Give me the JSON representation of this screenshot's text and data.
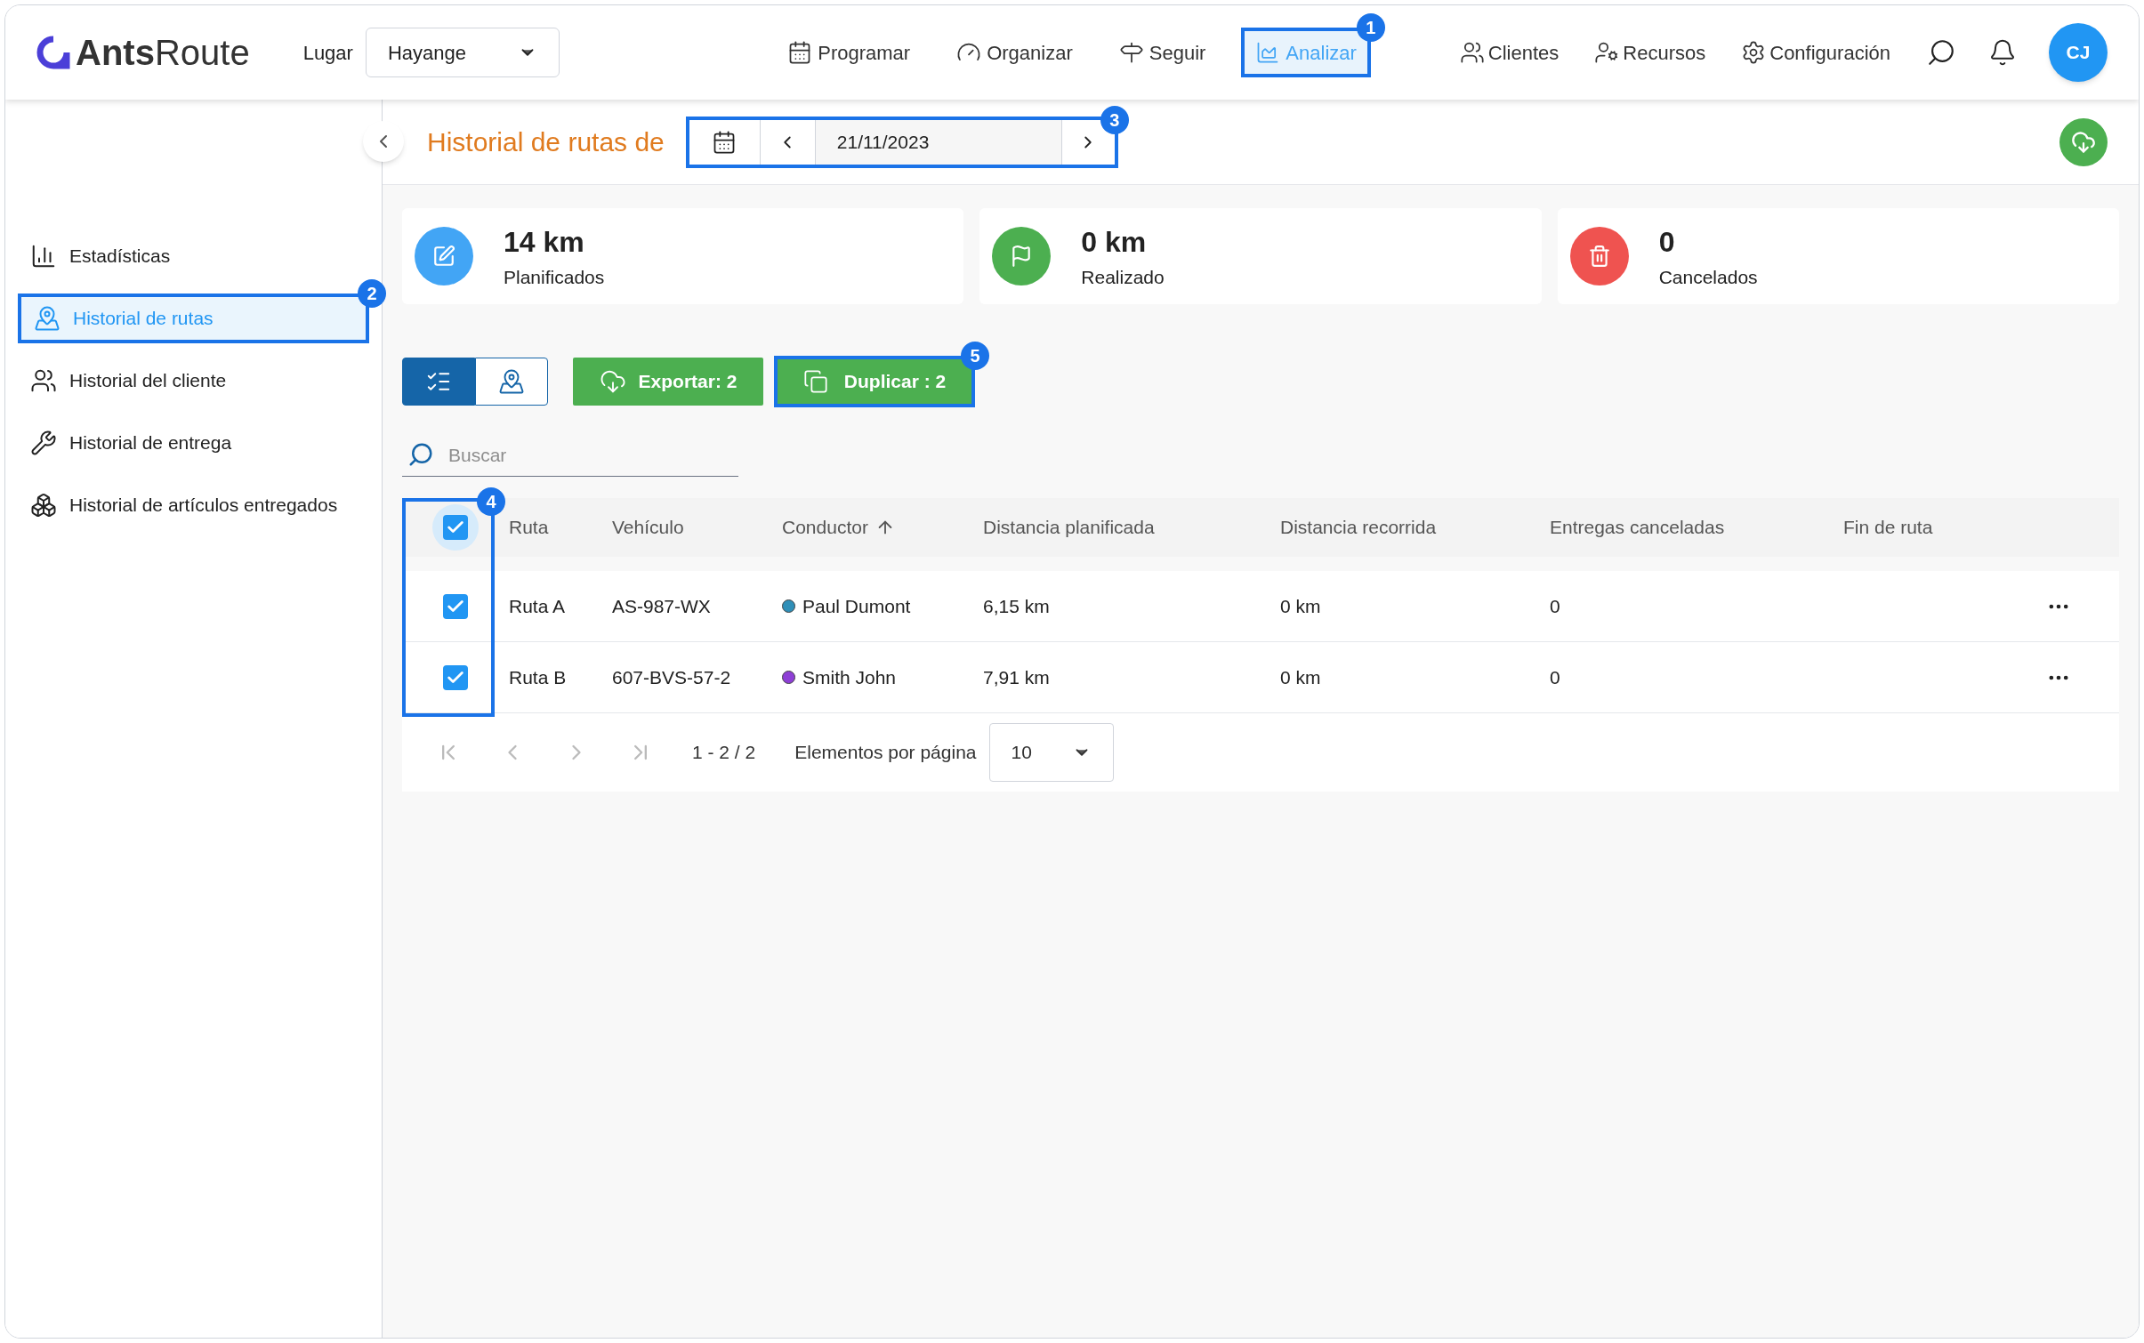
{
  "header": {
    "logo": {
      "bold": "Ants",
      "light": "Route"
    },
    "place_label": "Lugar",
    "place_select": {
      "value": "Hayange"
    },
    "nav": [
      {
        "label": "Programar",
        "selected": false
      },
      {
        "label": "Organizar",
        "selected": false
      },
      {
        "label": "Seguir",
        "selected": false
      },
      {
        "label": "Analizar",
        "selected": true,
        "callout": "1"
      }
    ],
    "right_nav": [
      {
        "label": "Clientes"
      },
      {
        "label": "Recursos"
      },
      {
        "label": "Configuración"
      }
    ],
    "avatar": "CJ"
  },
  "sidebar": {
    "items": [
      {
        "label": "Estadísticas",
        "selected": false
      },
      {
        "label": "Historial de rutas",
        "selected": true,
        "callout": "2"
      },
      {
        "label": "Historial del cliente",
        "selected": false
      },
      {
        "label": "Historial de entrega",
        "selected": false
      },
      {
        "label": "Historial de artículos entregados",
        "selected": false
      }
    ]
  },
  "page": {
    "title": "Historial de rutas de",
    "date": "21/11/2023",
    "date_callout": "3"
  },
  "stats": [
    {
      "value": "14 km",
      "label": "Planificados",
      "color": "#42a5f5"
    },
    {
      "value": "0 km",
      "label": "Realizado",
      "color": "#4caf50"
    },
    {
      "value": "0",
      "label": "Cancelados",
      "color": "#ef5350"
    }
  ],
  "toolbar": {
    "views": [
      {
        "selected": true
      },
      {
        "selected": false
      }
    ],
    "export_button": "Exportar: 2",
    "duplicate_button": {
      "label": "Duplicar : 2",
      "callout": "5"
    },
    "search": {
      "placeholder": "Buscar"
    }
  },
  "table": {
    "select_all_checked": true,
    "checkbox_callout": "4",
    "columns": [
      "Ruta",
      "Vehículo",
      "Conductor",
      "Distancia planificada",
      "Distancia recorrida",
      "Entregas canceladas",
      "Fin de ruta"
    ],
    "rows": [
      {
        "checked": true,
        "cells": [
          "Ruta A",
          "AS-987-WX",
          "Paul Dumont",
          "6,15 km",
          "0 km",
          "0"
        ],
        "color": "#2f8fb8"
      },
      {
        "checked": true,
        "cells": [
          "Ruta B",
          "607-BVS-57-2",
          "Smith John",
          "7,91 km",
          "0 km",
          "0"
        ],
        "color": "#8e3fd6"
      }
    ],
    "pagination": {
      "range": "1 - 2 / 2",
      "per_page_label": "Elementos por página",
      "per_page": "10"
    }
  }
}
